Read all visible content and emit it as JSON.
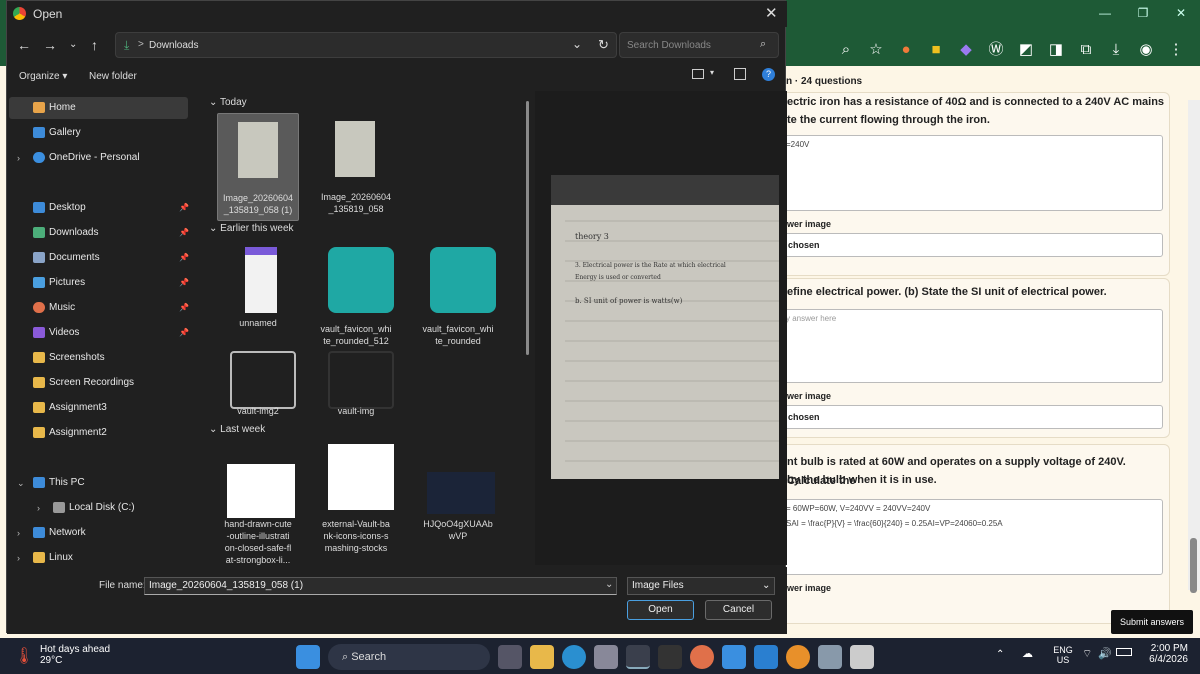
{
  "browser": {
    "window_controls": [
      "—",
      "❐",
      "✕"
    ],
    "header": "n · 24 questions",
    "q1": {
      "text1": "ectric iron has a resistance of 40Ω and is connected to a 240V AC mains",
      "text2": "te the current flowing through the iron.",
      "answer": "=240V",
      "img_label": "wer image",
      "img_value": "chosen"
    },
    "q2": {
      "text": "efine electrical power. (b) State the SI unit of electrical power.",
      "placeholder": "y answer here",
      "img_label": "wer image",
      "img_value": "chosen"
    },
    "q3": {
      "text1": "nt bulb is rated at 60W and operates on a supply voltage of 240V. Calculate the",
      "text2": "by the bulb when it is in use.",
      "ans1": "= 60WP=60W, V=240VV = 240VV=240V",
      "ans2": "SAI = \\frac{P}{V} = \\frac{60}{240} = 0.25AI=VP=24060=0.25A",
      "img_label": "wer image"
    },
    "submit": "Submit answers"
  },
  "dialog": {
    "title": "Open",
    "address": "Downloads",
    "address_sep": ">",
    "search_placeholder": "Search Downloads",
    "organize": "Organize ▾",
    "new_folder": "New folder",
    "sidebar": [
      {
        "label": "Home",
        "icon": "home-icon",
        "color": "#e8a44a"
      },
      {
        "label": "Gallery",
        "icon": "gallery-icon",
        "color": "#3d8bd9"
      },
      {
        "label": "OneDrive - Personal",
        "icon": "cloud-icon",
        "color": "#3b8fe0"
      },
      {
        "label": "Desktop",
        "icon": "desktop-icon",
        "color": "#3d8bd9"
      },
      {
        "label": "Downloads",
        "icon": "download-icon",
        "color": "#4cae7a"
      },
      {
        "label": "Documents",
        "icon": "document-icon",
        "color": "#8aa4c8"
      },
      {
        "label": "Pictures",
        "icon": "pictures-icon",
        "color": "#4a9fe0"
      },
      {
        "label": "Music",
        "icon": "music-icon",
        "color": "#e0704a"
      },
      {
        "label": "Videos",
        "icon": "video-icon",
        "color": "#8a5ad9"
      },
      {
        "label": "Screenshots",
        "icon": "folder-icon",
        "color": "#e8b84a"
      },
      {
        "label": "Screen Recordings",
        "icon": "folder-icon",
        "color": "#e8b84a"
      },
      {
        "label": "Assignment3",
        "icon": "folder-icon",
        "color": "#e8b84a"
      },
      {
        "label": "Assignment2",
        "icon": "folder-icon",
        "color": "#e8b84a"
      },
      {
        "label": "This PC",
        "icon": "pc-icon",
        "color": "#3d8bd9"
      },
      {
        "label": "Local Disk (C:)",
        "icon": "disk-icon",
        "color": "#999999"
      },
      {
        "label": "Network",
        "icon": "network-icon",
        "color": "#3d8bd9"
      },
      {
        "label": "Linux",
        "icon": "linux-icon",
        "color": "#e8b84a"
      }
    ],
    "groups": {
      "today": "Today",
      "earlier": "Earlier this week",
      "last": "Last week"
    },
    "files": [
      {
        "name": "Image_20260604\n_135819_058 (1)"
      },
      {
        "name": "Image_20260604\n_135819_058"
      },
      {
        "name": "unnamed"
      },
      {
        "name": "vault_favicon_whi\nte_rounded_512"
      },
      {
        "name": "vault_favicon_whi\nte_rounded"
      },
      {
        "name": "vault-img2"
      },
      {
        "name": "vault-img"
      },
      {
        "name": "hand-drawn-cute\n-outline-illustrati\non-closed-safe-fl\nat-strongbox-li..."
      },
      {
        "name": "external-Vault-ba\nnk-icons-icons-s\nmashing-stocks"
      },
      {
        "name": "HJQoO4gXUAAb\nwVP"
      }
    ],
    "preview_text": [
      "theory 3",
      "3. Electrical power is the Rate at which electrical",
      "Energy is used or converted",
      "b. SI unit of power is watts(w)"
    ],
    "filename_label": "File name:",
    "filename": "Image_20260604_135819_058 (1)",
    "filetype": "Image Files",
    "open": "Open",
    "cancel": "Cancel"
  },
  "taskbar": {
    "weather_title": "Hot days ahead",
    "weather_temp": "29°C",
    "search": "Search",
    "lang1": "ENG",
    "lang2": "US",
    "time": "2:00 PM",
    "date": "6/4/2026"
  }
}
